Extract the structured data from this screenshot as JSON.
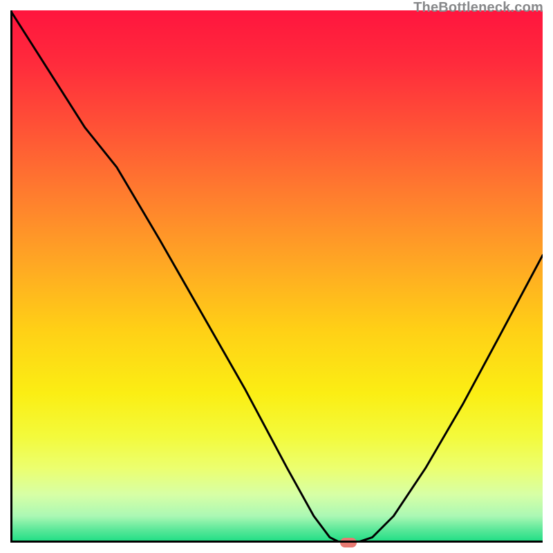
{
  "watermark": "TheBottleneck.com",
  "colors": {
    "gradient_stops": [
      {
        "offset": 0.0,
        "color": "#ff153e"
      },
      {
        "offset": 0.1,
        "color": "#ff2b3c"
      },
      {
        "offset": 0.22,
        "color": "#ff5236"
      },
      {
        "offset": 0.35,
        "color": "#ff7e2e"
      },
      {
        "offset": 0.48,
        "color": "#ffa923"
      },
      {
        "offset": 0.6,
        "color": "#ffd016"
      },
      {
        "offset": 0.72,
        "color": "#fbee14"
      },
      {
        "offset": 0.8,
        "color": "#f3fa3b"
      },
      {
        "offset": 0.86,
        "color": "#ecff6f"
      },
      {
        "offset": 0.91,
        "color": "#d7ffa6"
      },
      {
        "offset": 0.95,
        "color": "#abf8b4"
      },
      {
        "offset": 0.975,
        "color": "#5de89a"
      },
      {
        "offset": 1.0,
        "color": "#19dd83"
      }
    ],
    "curve": "#000000",
    "axis": "#000000",
    "marker": "#e77a72"
  },
  "chart_data": {
    "type": "line",
    "title": "",
    "xlabel": "",
    "ylabel": "",
    "xlim": [
      0,
      100
    ],
    "ylim": [
      0,
      100
    ],
    "grid": false,
    "legend_position": "none",
    "annotations": [
      {
        "text": "TheBottleneck.com",
        "x": 100,
        "y": 100,
        "anchor": "top-right"
      }
    ],
    "series": [
      {
        "name": "bottleneck-curve",
        "x": [
          0,
          7,
          14,
          20,
          28,
          36,
          44,
          52,
          57,
          60,
          62,
          65,
          68,
          72,
          78,
          85,
          92,
          100
        ],
        "values": [
          100,
          89,
          78,
          70.5,
          57,
          43,
          29,
          14,
          5,
          1,
          0,
          0,
          1,
          5,
          14,
          26,
          39,
          54
        ]
      }
    ],
    "marker": {
      "x": 63.5,
      "y": 0
    }
  }
}
